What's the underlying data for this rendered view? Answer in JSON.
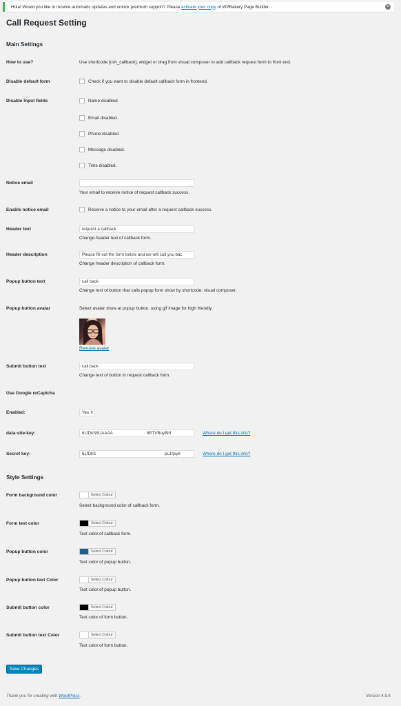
{
  "notice": {
    "text_before": "Hola! Would you like to receive automatic updates and unlock premium support? Please",
    "link": "activate your copy",
    "text_after": "of WPBakery Page Builder.",
    "dismiss_icon": "close-icon"
  },
  "page_title": "Call Request Setting",
  "main_settings": {
    "title": "Main Settings",
    "how_to_use": {
      "label": "How to use?",
      "text": "Use shortcode [csh_callback], widget or drag from visual composer to add callback request form to front end."
    },
    "disable_default_form": {
      "label": "Disable default form",
      "checkbox_label": "Check if you want to disable default callback form in frontend.",
      "checked": false
    },
    "disable_input_fields": {
      "label": "Disable Input fields",
      "options": [
        {
          "label": "Name disabled.",
          "checked": false
        },
        {
          "label": "Email disabled.",
          "checked": false
        },
        {
          "label": "Phone disabled.",
          "checked": false
        },
        {
          "label": "Message disabled.",
          "checked": false
        },
        {
          "label": "Time disabled.",
          "checked": false
        }
      ]
    },
    "notice_email": {
      "label": "Notice email",
      "value": "",
      "desc": "Your email to receive notice of request callback success."
    },
    "enable_notice_email": {
      "label": "Enable notice email",
      "checkbox_label": "Receive a notice to your email after a request callback success.",
      "checked": false
    },
    "header_text": {
      "label": "Header text",
      "value": "request a callback",
      "desc": "Change header text of callback form."
    },
    "header_description": {
      "label": "Header description",
      "value": "Please fill out the form below and we will call you bac",
      "desc": "Change header description of callback form."
    },
    "popup_button_text": {
      "label": "Popup button text",
      "value": "call back",
      "desc": "Change text of button that calls popup form show by shortcode, visual composer."
    },
    "popup_button_avatar": {
      "label": "Popup button avatar",
      "desc": "Select avatar show at popup button, using gif image for high friendly.",
      "remove_link": "Remove avatar"
    },
    "submit_button_text": {
      "label": "Submit button text",
      "value": "call back",
      "desc": "Change text of button in request callback form."
    },
    "recaptcha": {
      "label": "Use Google reCaptcha",
      "enabled_label": "Enabled:",
      "enabled_value": "Yes",
      "site_key_label": "data-site-key:",
      "site_key_value": "6LfDkS8UAAAA",
      "site_key_value_end": "8BTVBoyBhf",
      "secret_key_label": "Secret key:",
      "secret_key_value": "6LfDkS",
      "secret_key_value_end": "pL1fjxy8",
      "help_link": "Where do I get this info?"
    }
  },
  "style_settings": {
    "title": "Style Settings",
    "select_colour_label": "Select Colour",
    "items": [
      {
        "label": "Form background color",
        "color": "#ffffff",
        "desc": "Select background color of callback form."
      },
      {
        "label": "Form text color",
        "color": "#000000",
        "desc": "Text color of callback form."
      },
      {
        "label": "Popup button color",
        "color": "#1e5f8f",
        "desc": "Text color of popup button."
      },
      {
        "label": "Popup button text Color",
        "color": "#ffffff",
        "desc": "Text color of popup button."
      },
      {
        "label": "Submit button color",
        "color": "#000000",
        "desc": "Text color of form button."
      },
      {
        "label": "Submit button text Color",
        "color": "#ffffff",
        "desc": "Text color of form button."
      }
    ]
  },
  "save_button": "Save Changes",
  "footer": {
    "text": "Thank you for creating with",
    "link": "WordPress",
    "period": ".",
    "version": "Version 4.9.4"
  }
}
